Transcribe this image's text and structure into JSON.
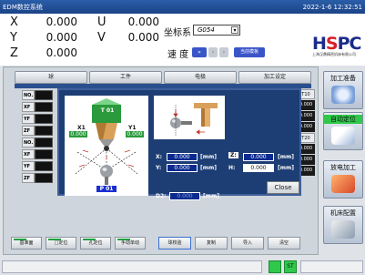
{
  "window": {
    "title": "EDM数控系统",
    "datetime": "2022-1-6 12:32:51"
  },
  "coords": {
    "x_label": "X",
    "x_value": "0.000",
    "y_label": "Y",
    "y_value": "0.000",
    "z_label": "Z",
    "z_value": "0.000",
    "u_label": "U",
    "u_value": "0.000",
    "v_label": "V",
    "v_value": "0.000",
    "coord_sys_label": "坐标系",
    "coord_sys_value": "G054",
    "speed_label": "速 度",
    "speed_button": "当前模板"
  },
  "logo": {
    "text_main": "HSPC",
    "subtitle": "上海汉鼎精密机床有限公司"
  },
  "tabs": [
    "球",
    "工件",
    "电极",
    "加工设定"
  ],
  "left_table": [
    {
      "head": "NO.",
      "value": "T1"
    },
    {
      "head": "XF",
      "value": "0.0"
    },
    {
      "head": "YF",
      "value": "0.0"
    },
    {
      "head": "ZF",
      "value": "0.0"
    },
    {
      "head": "NO.",
      "value": "T1"
    },
    {
      "head": "XF",
      "value": "0.0"
    },
    {
      "head": "YF",
      "value": "0.0"
    },
    {
      "head": "ZF",
      "value": "0.0"
    }
  ],
  "right_table": [
    "T10",
    "0.000",
    "0.000",
    "0.000",
    "T20",
    "0.000",
    "0.000",
    "0.000"
  ],
  "dialog": {
    "tool_label": "T 01",
    "x1_label": "X1",
    "x1_value": "0.000",
    "y1_label": "Y1",
    "y1_value": "0.000",
    "probe_label": "P 01",
    "x_label": "X:",
    "x_value": "0.000",
    "y_label": "Y:",
    "y_value": "0.000",
    "z_label": "Z:",
    "z_value": "0.000",
    "h_label": "H:",
    "h_value": "0.000",
    "d2_label": "D2:",
    "d2_value": "0.000",
    "unit": "[mm]",
    "close": "Close"
  },
  "bottom_buttons": [
    "基准面",
    "□定位",
    "孔定位",
    "手动单动",
    "球校验",
    "复制",
    "导入",
    "清空"
  ],
  "side_buttons": [
    "加工准备",
    "自动定位",
    "放电加工",
    "机床配置"
  ],
  "status": {
    "st_label": "ST"
  },
  "colors": {
    "titlebar": "#1c4387",
    "accent_green": "#2fc84a",
    "dialog_bg": "#1d3e74"
  }
}
